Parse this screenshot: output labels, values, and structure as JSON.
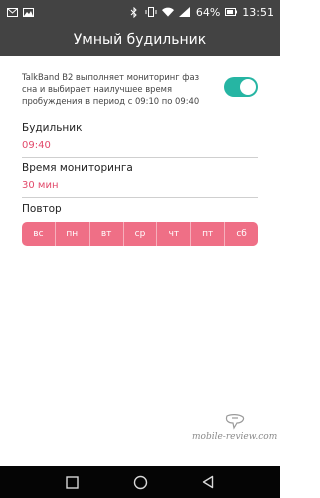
{
  "status_bar": {
    "battery_percent": "64%",
    "time": "13:51",
    "icons": [
      "mail-icon",
      "image-icon",
      "bluetooth-icon",
      "vibrate-icon",
      "wifi-icon",
      "signal-icon",
      "battery-icon"
    ]
  },
  "header": {
    "title": "Умный будильник"
  },
  "monitoring": {
    "text": "TalkBand B2 выполняет мониторинг фаз сна и выбирает наилучшее время пробуждения в период с 09:10 по 09:40",
    "toggle_on": true,
    "toggle_color": "#26b5a3"
  },
  "alarm": {
    "label": "Будильник",
    "value": "09:40"
  },
  "monitoring_time": {
    "label": "Время мониторинга",
    "value": "30 мин"
  },
  "repeat": {
    "label": "Повтор",
    "days": [
      "вс",
      "пн",
      "вт",
      "ср",
      "чт",
      "пт",
      "сб"
    ],
    "color": "#ef6f86"
  },
  "watermark": {
    "text": "mobile-review.com"
  },
  "colors": {
    "accent_pink": "#e24a6b",
    "bar_dark": "#434343"
  }
}
